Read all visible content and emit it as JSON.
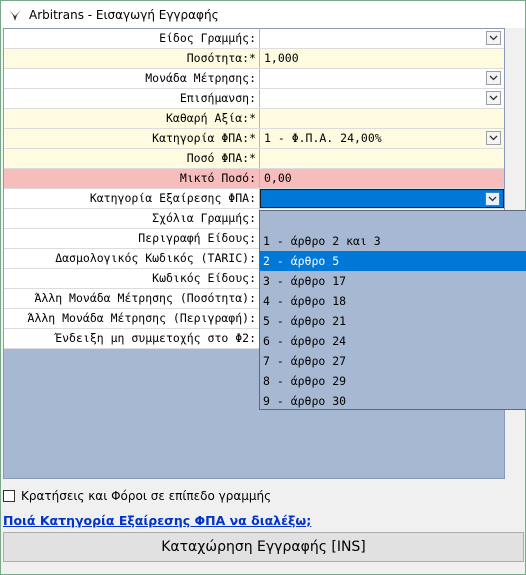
{
  "window": {
    "title": "Arbitrans - Εισαγωγή Εγγραφής"
  },
  "fields": [
    {
      "label": "Είδος Γραμμής:",
      "value": "",
      "dropdown": true,
      "style": "white"
    },
    {
      "label": "Ποσότητα:*",
      "value": "1,000",
      "dropdown": false,
      "style": "yellow"
    },
    {
      "label": "Μονάδα Μέτρησης:",
      "value": "",
      "dropdown": true,
      "style": "white"
    },
    {
      "label": "Επισήμανση:",
      "value": "",
      "dropdown": true,
      "style": "white"
    },
    {
      "label": "Καθαρή Αξία:*",
      "value": "",
      "dropdown": false,
      "style": "yellow"
    },
    {
      "label": "Κατηγορία ΦΠΑ:*",
      "value": "1 - Φ.Π.Α. 24,00%",
      "dropdown": true,
      "style": "yellow"
    },
    {
      "label": "Ποσό ΦΠΑ:*",
      "value": "",
      "dropdown": false,
      "style": "yellow"
    },
    {
      "label": "Μικτό Ποσό:",
      "value": "0,00",
      "dropdown": false,
      "style": "pink"
    },
    {
      "label": "Κατηγορία Εξαίρεσης ΦΠΑ:",
      "value": "",
      "dropdown": true,
      "style": "active"
    },
    {
      "label": "Σχόλια Γραμμής:",
      "value": "",
      "dropdown": false,
      "style": "white"
    },
    {
      "label": "Περιγραφή Είδους:",
      "value": "",
      "dropdown": false,
      "style": "white"
    },
    {
      "label": "Δασμολογικός Κωδικός (TARIC):",
      "value": "",
      "dropdown": false,
      "style": "white"
    },
    {
      "label": "Κωδικός Είδους:",
      "value": "",
      "dropdown": false,
      "style": "white"
    },
    {
      "label": "Άλλη Μονάδα Μέτρησης (Ποσότητα):",
      "value": "",
      "dropdown": false,
      "style": "white"
    },
    {
      "label": "Άλλη Μονάδα Μέτρησης (Περιγραφή):",
      "value": "",
      "dropdown": false,
      "style": "white"
    },
    {
      "label": "Ένδειξη μη συμμετοχής στο Φ2:",
      "value": "",
      "dropdown": false,
      "style": "white"
    }
  ],
  "dropdown_options": [
    {
      "label": "",
      "selected": false
    },
    {
      "label": "1 - άρθρο 2 και 3",
      "selected": false
    },
    {
      "label": "2 - άρθρο 5",
      "selected": true
    },
    {
      "label": "3 - άρθρο 17",
      "selected": false
    },
    {
      "label": "4 - άρθρο 18",
      "selected": false
    },
    {
      "label": "5 - άρθρο 21",
      "selected": false
    },
    {
      "label": "6 - άρθρο 24",
      "selected": false
    },
    {
      "label": "7 - άρθρο 27",
      "selected": false
    },
    {
      "label": "8 - άρθρο 29",
      "selected": false
    },
    {
      "label": "9 - άρθρο 30",
      "selected": false
    }
  ],
  "checkbox": {
    "label": "Κρατήσεις και Φόροι σε επίπεδο γραμμής",
    "checked": false
  },
  "help_link": "Ποιά Κατηγορία Εξαίρεσης ΦΠΑ να διαλέξω;",
  "submit_button": "Καταχώρηση Εγγραφής [INS]",
  "colors": {
    "accent": "#0078d7",
    "grid_bg": "#a7b9d2",
    "required_bg": "#fffbe1",
    "total_bg": "#f7bcbc",
    "link": "#0033cc"
  }
}
